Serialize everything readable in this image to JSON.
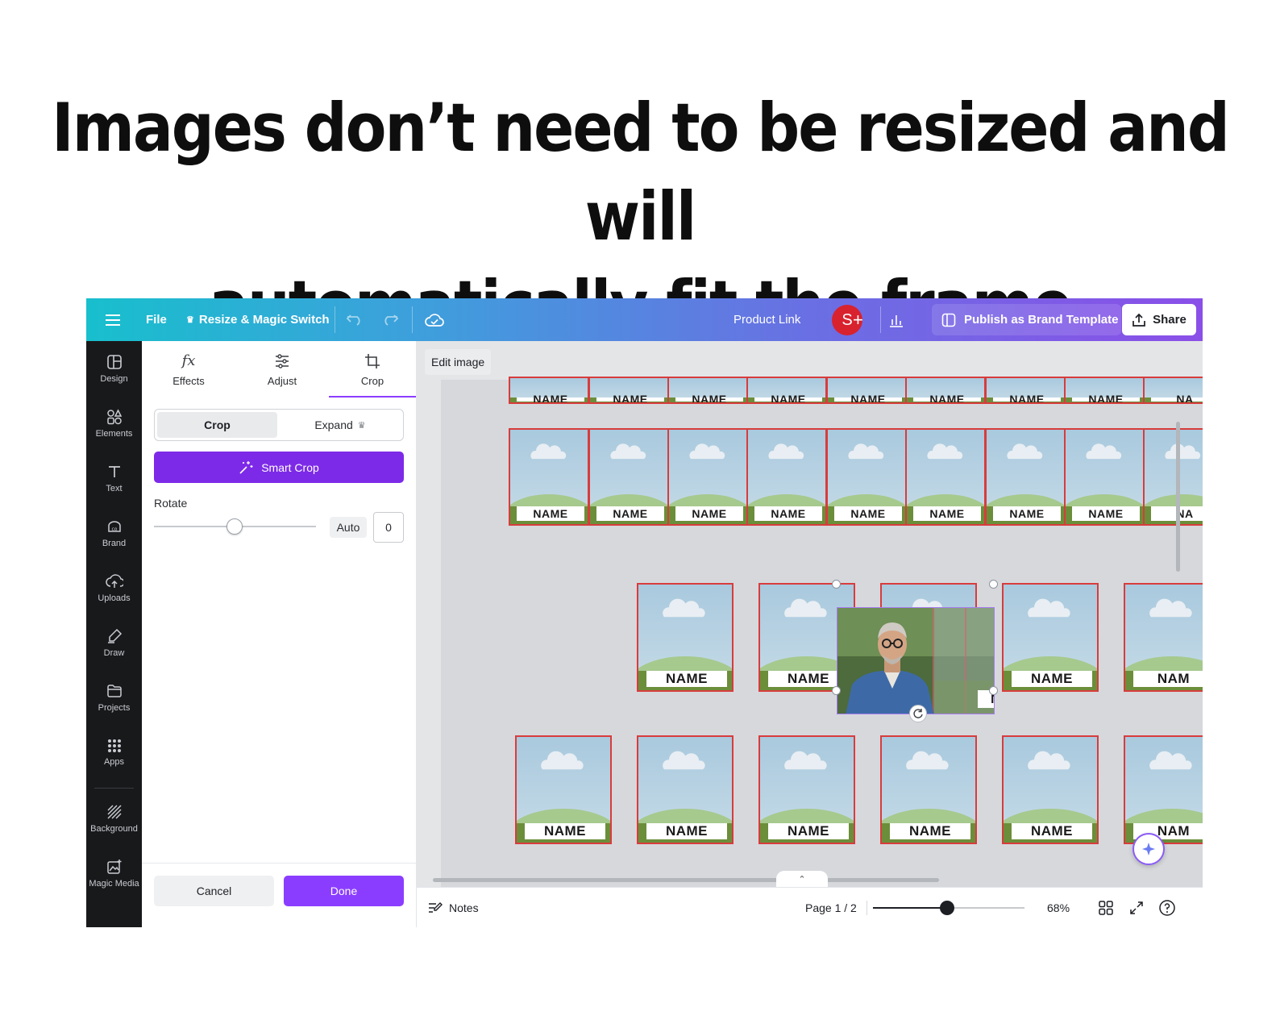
{
  "headline": {
    "line1": "Images don’t need to be resized and will",
    "line2": "automatically fit the frame"
  },
  "topbar": {
    "menu_icon": "hamburger-icon",
    "file_label": "File",
    "resize_label": "Resize & Magic Switch",
    "product_link_label": "Product Link",
    "avatar_initial": "S",
    "publish_label": "Publish as Brand Template",
    "share_label": "Share"
  },
  "rail": {
    "items": [
      {
        "label": "Design",
        "icon": "layout-icon"
      },
      {
        "label": "Elements",
        "icon": "shapes-icon"
      },
      {
        "label": "Text",
        "icon": "text-icon"
      },
      {
        "label": "Brand",
        "icon": "brand-icon"
      },
      {
        "label": "Uploads",
        "icon": "cloud-upload-icon"
      },
      {
        "label": "Draw",
        "icon": "pen-icon"
      },
      {
        "label": "Projects",
        "icon": "folder-icon"
      },
      {
        "label": "Apps",
        "icon": "grid-icon"
      },
      {
        "label": "Background",
        "icon": "pattern-icon"
      },
      {
        "label": "Magic Media",
        "icon": "magic-media-icon"
      }
    ]
  },
  "panel": {
    "tabs": [
      {
        "label": "Effects",
        "icon": "fx-icon"
      },
      {
        "label": "Adjust",
        "icon": "sliders-icon"
      },
      {
        "label": "Crop",
        "icon": "crop-icon"
      }
    ],
    "active_tab": "Crop",
    "crop_segment": "Crop",
    "expand_segment": "Expand",
    "smart_crop_label": "Smart Crop",
    "rotate_label": "Rotate",
    "rotate_slider_fraction": 0.5,
    "auto_label": "Auto",
    "rotate_value": "0",
    "cancel_label": "Cancel",
    "done_label": "Done"
  },
  "canvas": {
    "edit_image_label": "Edit image",
    "frame_label": "NAME",
    "frame_label_cut": "NA",
    "frame_label_cut2": "NAM",
    "overlap_label": "NAME"
  },
  "bottombar": {
    "notes_label": "Notes",
    "page_label": "Page 1 / 2",
    "zoom_label": "68%",
    "zoom_fraction": 0.49
  },
  "colors": {
    "accent": "#8b3dff",
    "frame_border": "#d83c3c",
    "avatar": "#d8222e"
  }
}
